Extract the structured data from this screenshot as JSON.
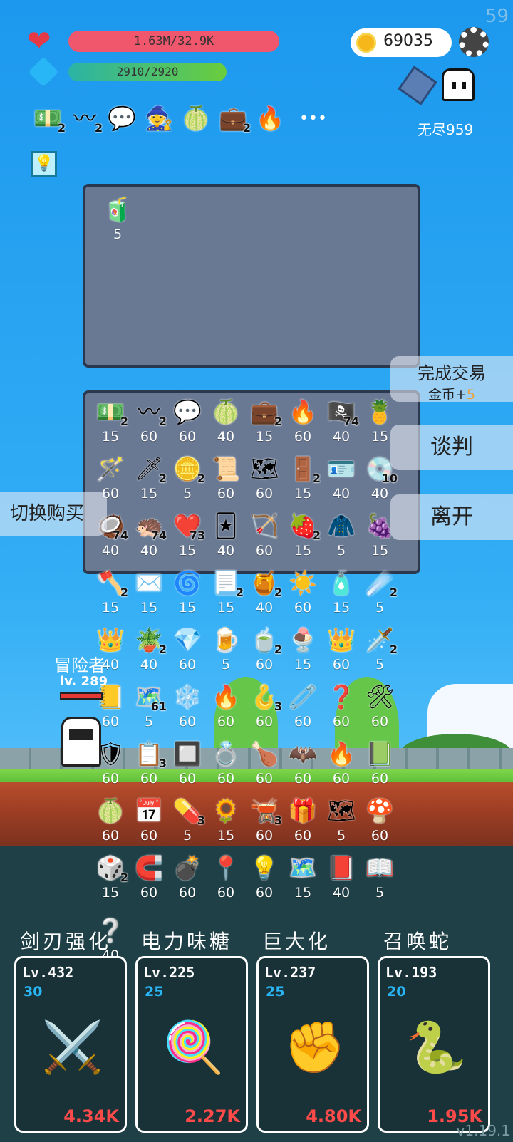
{
  "fps": "59",
  "hp": {
    "text": "1.63M/32.9K",
    "fill": 1.0
  },
  "mp": {
    "text": "2910/2920",
    "fill": 0.997
  },
  "coins": "69035",
  "mode": "无尽959",
  "buffs": [
    {
      "icon": "💵",
      "count": "2"
    },
    {
      "icon": "〰",
      "count": "2"
    },
    {
      "icon": "💬",
      "count": ""
    },
    {
      "icon": "🧙",
      "count": ""
    },
    {
      "icon": "🍈",
      "count": ""
    },
    {
      "icon": "💼",
      "count": "2"
    },
    {
      "icon": "🔥",
      "count": ""
    }
  ],
  "more": "•••",
  "trade_slot": {
    "icon": "🧃",
    "price": "5"
  },
  "shop_items": [
    {
      "icon": "💵",
      "count": "2",
      "price": "15"
    },
    {
      "icon": "〰",
      "count": "2",
      "price": "60"
    },
    {
      "icon": "💬",
      "count": "",
      "price": "60"
    },
    {
      "icon": "🍈",
      "count": "",
      "price": "40"
    },
    {
      "icon": "💼",
      "count": "2",
      "price": "15"
    },
    {
      "icon": "🔥",
      "count": "",
      "price": "60"
    },
    {
      "icon": "🏴‍☠️",
      "count": "74",
      "price": "40"
    },
    {
      "icon": "🍍",
      "count": "",
      "price": "15"
    },
    {
      "icon": "🪄",
      "count": "",
      "price": "60"
    },
    {
      "icon": "🗡",
      "count": "2",
      "price": "15"
    },
    {
      "icon": "🪙",
      "count": "2",
      "price": "5"
    },
    {
      "icon": "📜",
      "count": "",
      "price": "60"
    },
    {
      "icon": "🗺",
      "count": "",
      "price": "60"
    },
    {
      "icon": "🚪",
      "count": "2",
      "price": "15"
    },
    {
      "icon": "🪪",
      "count": "",
      "price": "40"
    },
    {
      "icon": "💿",
      "count": "10",
      "price": "40"
    },
    {
      "icon": "🥥",
      "count": "74",
      "price": "40"
    },
    {
      "icon": "🦔",
      "count": "74",
      "price": "40"
    },
    {
      "icon": "❤️",
      "count": "73",
      "price": "15"
    },
    {
      "icon": "🃏",
      "count": "",
      "price": "40"
    },
    {
      "icon": "🏹",
      "count": "",
      "price": "60"
    },
    {
      "icon": "🍓",
      "count": "2",
      "price": "15"
    },
    {
      "icon": "🧥",
      "count": "",
      "price": "5"
    },
    {
      "icon": "🍇",
      "count": "",
      "price": "15"
    },
    {
      "icon": "🪓",
      "count": "2",
      "price": "15"
    },
    {
      "icon": "✉️",
      "count": "",
      "price": "15"
    },
    {
      "icon": "🌀",
      "count": "",
      "price": "15"
    },
    {
      "icon": "📃",
      "count": "2",
      "price": "15"
    },
    {
      "icon": "🍯",
      "count": "2",
      "price": "40"
    },
    {
      "icon": "☀️",
      "count": "",
      "price": "60"
    },
    {
      "icon": "🧴",
      "count": "",
      "price": "15"
    },
    {
      "icon": "☄️",
      "count": "2",
      "price": "5"
    },
    {
      "icon": "👑",
      "count": "",
      "price": "40"
    },
    {
      "icon": "🪴",
      "count": "2",
      "price": "40"
    },
    {
      "icon": "💎",
      "count": "",
      "price": "60"
    },
    {
      "icon": "🍺",
      "count": "",
      "price": "5"
    },
    {
      "icon": "🍵",
      "count": "2",
      "price": "60"
    },
    {
      "icon": "🍨",
      "count": "",
      "price": "15"
    },
    {
      "icon": "👑",
      "count": "",
      "price": "60"
    },
    {
      "icon": "🗡️",
      "count": "2",
      "price": "5"
    },
    {
      "icon": "📒",
      "count": "",
      "price": "60"
    },
    {
      "icon": "🗺️",
      "count": "61",
      "price": "5"
    },
    {
      "icon": "❄️",
      "count": "",
      "price": "60"
    },
    {
      "icon": "🔥",
      "count": "",
      "price": "60"
    },
    {
      "icon": "🪝",
      "count": "3",
      "price": "60"
    },
    {
      "icon": "🧷",
      "count": "",
      "price": "60"
    },
    {
      "icon": "❓",
      "count": "",
      "price": "60"
    },
    {
      "icon": "🛠",
      "count": "",
      "price": "60"
    },
    {
      "icon": "🛡",
      "count": "",
      "price": "60"
    },
    {
      "icon": "📋",
      "count": "3",
      "price": "60"
    },
    {
      "icon": "🔲",
      "count": "",
      "price": "60"
    },
    {
      "icon": "💍",
      "count": "",
      "price": "60"
    },
    {
      "icon": "🍗",
      "count": "",
      "price": "60"
    },
    {
      "icon": "🦇",
      "count": "",
      "price": "60"
    },
    {
      "icon": "🔥",
      "count": "",
      "price": "60"
    },
    {
      "icon": "📗",
      "count": "",
      "price": "60"
    },
    {
      "icon": "🍈",
      "count": "",
      "price": "60"
    },
    {
      "icon": "📅",
      "count": "",
      "price": "60"
    },
    {
      "icon": "💊",
      "count": "3",
      "price": "5"
    },
    {
      "icon": "🌻",
      "count": "",
      "price": "15"
    },
    {
      "icon": "🫕",
      "count": "3",
      "price": "60"
    },
    {
      "icon": "🎁",
      "count": "",
      "price": "60"
    },
    {
      "icon": "🗺",
      "count": "",
      "price": "5"
    },
    {
      "icon": "🍄",
      "count": "",
      "price": "60"
    },
    {
      "icon": "🎲",
      "count": "2",
      "price": "15"
    },
    {
      "icon": "🧲",
      "count": "",
      "price": "60"
    },
    {
      "icon": "💣",
      "count": "",
      "price": "60"
    },
    {
      "icon": "📍",
      "count": "",
      "price": "60"
    },
    {
      "icon": "💡",
      "count": "",
      "price": "60"
    },
    {
      "icon": "🗺️",
      "count": "",
      "price": "15"
    },
    {
      "icon": "📕",
      "count": "",
      "price": "40"
    },
    {
      "icon": "📖",
      "count": "",
      "price": "5"
    }
  ],
  "extra_item": {
    "icon": "❔",
    "price": "40"
  },
  "buttons": {
    "complete": "完成交易",
    "complete_reward_label": "金币+",
    "complete_reward_value": "5",
    "negotiate": "谈判",
    "leave": "离开",
    "switch": "切换购买"
  },
  "hero": {
    "title": "冒险者",
    "level": "lv. 289"
  },
  "skills": [
    {
      "name": "剑刃强化",
      "level": "Lv.432",
      "cost": "30",
      "icon": "⚔️",
      "damage": "4.34K"
    },
    {
      "name": "电力味糖",
      "level": "Lv.225",
      "cost": "25",
      "icon": "🍭",
      "damage": "2.27K"
    },
    {
      "name": "巨大化",
      "level": "Lv.237",
      "cost": "25",
      "icon": "✊",
      "damage": "4.80K"
    },
    {
      "name": "召唤蛇",
      "level": "Lv.193",
      "cost": "20",
      "icon": "🐍",
      "damage": "1.95K"
    }
  ],
  "version": "v1.19.1",
  "colors": {
    "hp": "#f0566c",
    "mp": "#52c24a",
    "reward": "#f0a030",
    "damage": "#ff4a4a",
    "cost": "#29b6f6"
  }
}
